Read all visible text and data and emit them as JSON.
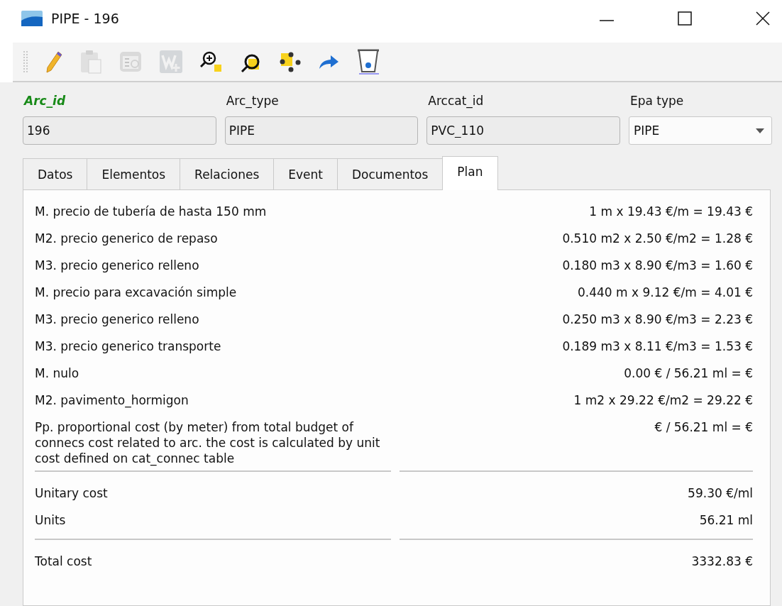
{
  "window": {
    "title": "PIPE - 196"
  },
  "toolbar": [
    {
      "kind": "pencil",
      "disabled": false
    },
    {
      "kind": "clipboard",
      "disabled": true
    },
    {
      "kind": "calculator",
      "disabled": true
    },
    {
      "kind": "add",
      "disabled": true
    },
    {
      "kind": "zoom",
      "disabled": false
    },
    {
      "kind": "magnifier",
      "disabled": false
    },
    {
      "kind": "nodes",
      "disabled": false
    },
    {
      "kind": "arrow",
      "disabled": false
    },
    {
      "kind": "bin",
      "disabled": false
    }
  ],
  "fields": [
    {
      "label": "Arc_id",
      "required": true,
      "value": "196",
      "kind": "text"
    },
    {
      "label": "Arc_type",
      "required": false,
      "value": "PIPE",
      "kind": "text"
    },
    {
      "label": "Arccat_id",
      "required": false,
      "value": "PVC_110",
      "kind": "text"
    },
    {
      "label": "Epa type",
      "required": false,
      "value": "PIPE",
      "kind": "dropdown"
    }
  ],
  "tabs": [
    {
      "label": "Datos",
      "selected": false
    },
    {
      "label": "Elementos",
      "selected": false
    },
    {
      "label": "Relaciones",
      "selected": false
    },
    {
      "label": "Event",
      "selected": false
    },
    {
      "label": "Documentos",
      "selected": false
    },
    {
      "label": "Plan",
      "selected": true
    }
  ],
  "plan": {
    "items": [
      {
        "label": "M. precio de tubería de hasta 150 mm",
        "value": "1 m x 19.43 €/m = 19.43 €"
      },
      {
        "label": "M2. precio generico de repaso",
        "value": "0.510 m2 x 2.50 €/m2 = 1.28 €"
      },
      {
        "label": "M3. precio generico relleno",
        "value": "0.180 m3 x 8.90 €/m3 = 1.60 €"
      },
      {
        "label": "M. precio para excavación simple",
        "value": "0.440 m x 9.12 €/m = 4.01 €"
      },
      {
        "label": "M3. precio generico relleno",
        "value": "0.250 m3 x 8.90 €/m3 = 2.23 €"
      },
      {
        "label": "M3. precio generico transporte",
        "value": "0.189 m3 x 8.11 €/m3 = 1.53 €"
      },
      {
        "label": "M. nulo",
        "value": "0.00 € / 56.21 ml =  €"
      },
      {
        "label": "M2. pavimento_hormigon",
        "value": "1 m2 x 29.22 €/m2 = 29.22 €"
      },
      {
        "label": "Pp. proportional cost (by meter) from total budget of connecs cost related to arc. the cost is calculated by unit cost defined on cat_connec table",
        "value": "€ / 56.21 ml =  €"
      }
    ],
    "summary": [
      {
        "label": "Unitary cost",
        "value": "59.30 €/ml"
      },
      {
        "label": "Units",
        "value": "56.21 ml"
      }
    ],
    "total": {
      "label": "Total cost",
      "value": "3332.83 €"
    }
  }
}
